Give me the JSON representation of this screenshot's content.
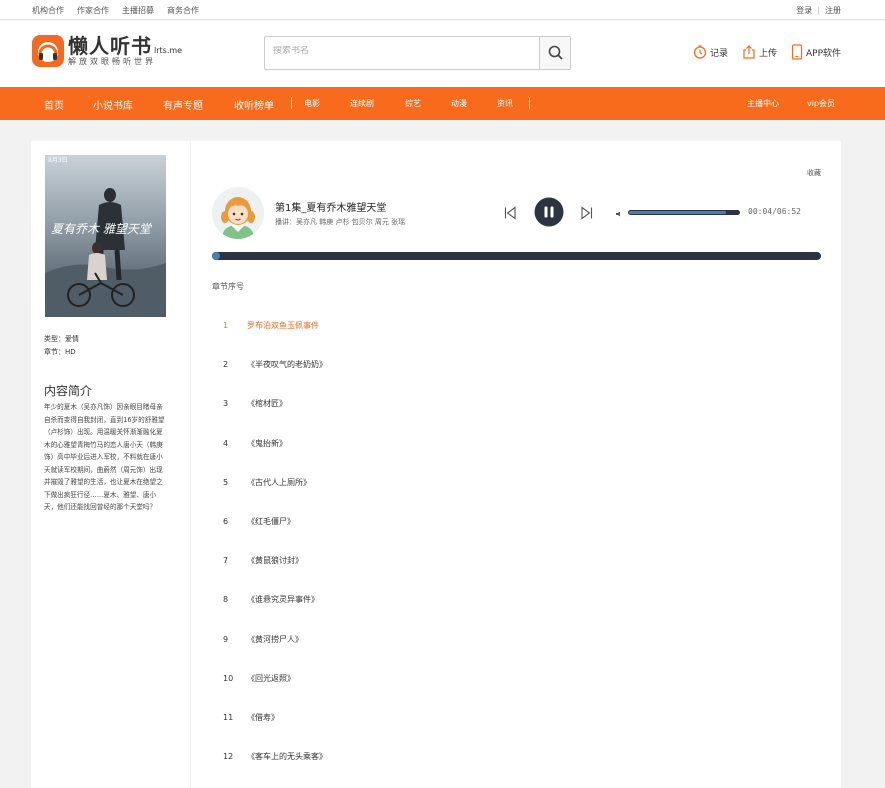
{
  "topbar": {
    "links": [
      "机构合作",
      "作家合作",
      "主播招募",
      "商务合作"
    ],
    "login": "登录",
    "sep": "|",
    "register": "注册"
  },
  "logo": {
    "name": "懒人听书",
    "domain": "lrts.me",
    "slogan": "解放双眼畅听世界"
  },
  "search": {
    "placeholder": "搜索书名"
  },
  "header": {
    "history": "记录",
    "upload": "上传",
    "app": "APP软件"
  },
  "nav": {
    "main": [
      "首页",
      "小说书库",
      "有声专题",
      "收听榜单"
    ],
    "sep": "|",
    "sub": [
      "电影",
      "连续剧",
      "综艺",
      "动漫",
      "资讯"
    ],
    "right": [
      "主播中心",
      "vip会员"
    ]
  },
  "poster": {
    "date": "8月3日",
    "title": "夏有乔木 雅望天堂"
  },
  "info": {
    "type": "类型：爱情",
    "chapter": "章节：HD"
  },
  "intro": {
    "heading": "内容简介",
    "text": "年少的夏木（吴亦凡饰）因亲眼目睹母亲自杀而变得自我封闭，直到16岁的舒雅望（卢杉饰）出现。用温暖关怀渐渐融化夏木的心雅望青梅竹马的恋人唐小天（韩庚饰）高中毕业后进入军校，不料就在唐小天就读军校期间，曲蔚然（周元饰）出现并摧毁了雅望的生活，也让夏木在绝望之下做出疯狂行径……夏木、雅望、唐小天，他们还能找回曾经的那个天堂吗？"
  },
  "player": {
    "favorite": "收藏",
    "title": "第1集_夏有乔木雅望天堂",
    "cast": "播讲：吴亦凡 韩庚 卢杉 包贝尔 周元 张瑶",
    "time": "00:04/06:52",
    "volume": 0.88,
    "progress": 0.0097
  },
  "chapters": {
    "heading": "章节序号",
    "items": [
      {
        "num": "1",
        "title": "罗布泊双鱼玉佩事件"
      },
      {
        "num": "2",
        "title": "《半夜叹气的老奶奶》"
      },
      {
        "num": "3",
        "title": "《棺材匠》"
      },
      {
        "num": "4",
        "title": "《鬼抬新》"
      },
      {
        "num": "5",
        "title": "《古代人上厕所》"
      },
      {
        "num": "6",
        "title": "《红毛僵尸》"
      },
      {
        "num": "7",
        "title": "《黄鼠狼讨封》"
      },
      {
        "num": "8",
        "title": "《谁悬究灵异事件》"
      },
      {
        "num": "9",
        "title": "《黄河捞尸人》"
      },
      {
        "num": "10",
        "title": "《回光返照》"
      },
      {
        "num": "11",
        "title": "《借寿》"
      },
      {
        "num": "12",
        "title": "《客车上的无头乘客》"
      }
    ]
  },
  "colors": {
    "accent": "#f86b1d",
    "dark": "#2b3440",
    "progress": "#4a7cb5"
  }
}
